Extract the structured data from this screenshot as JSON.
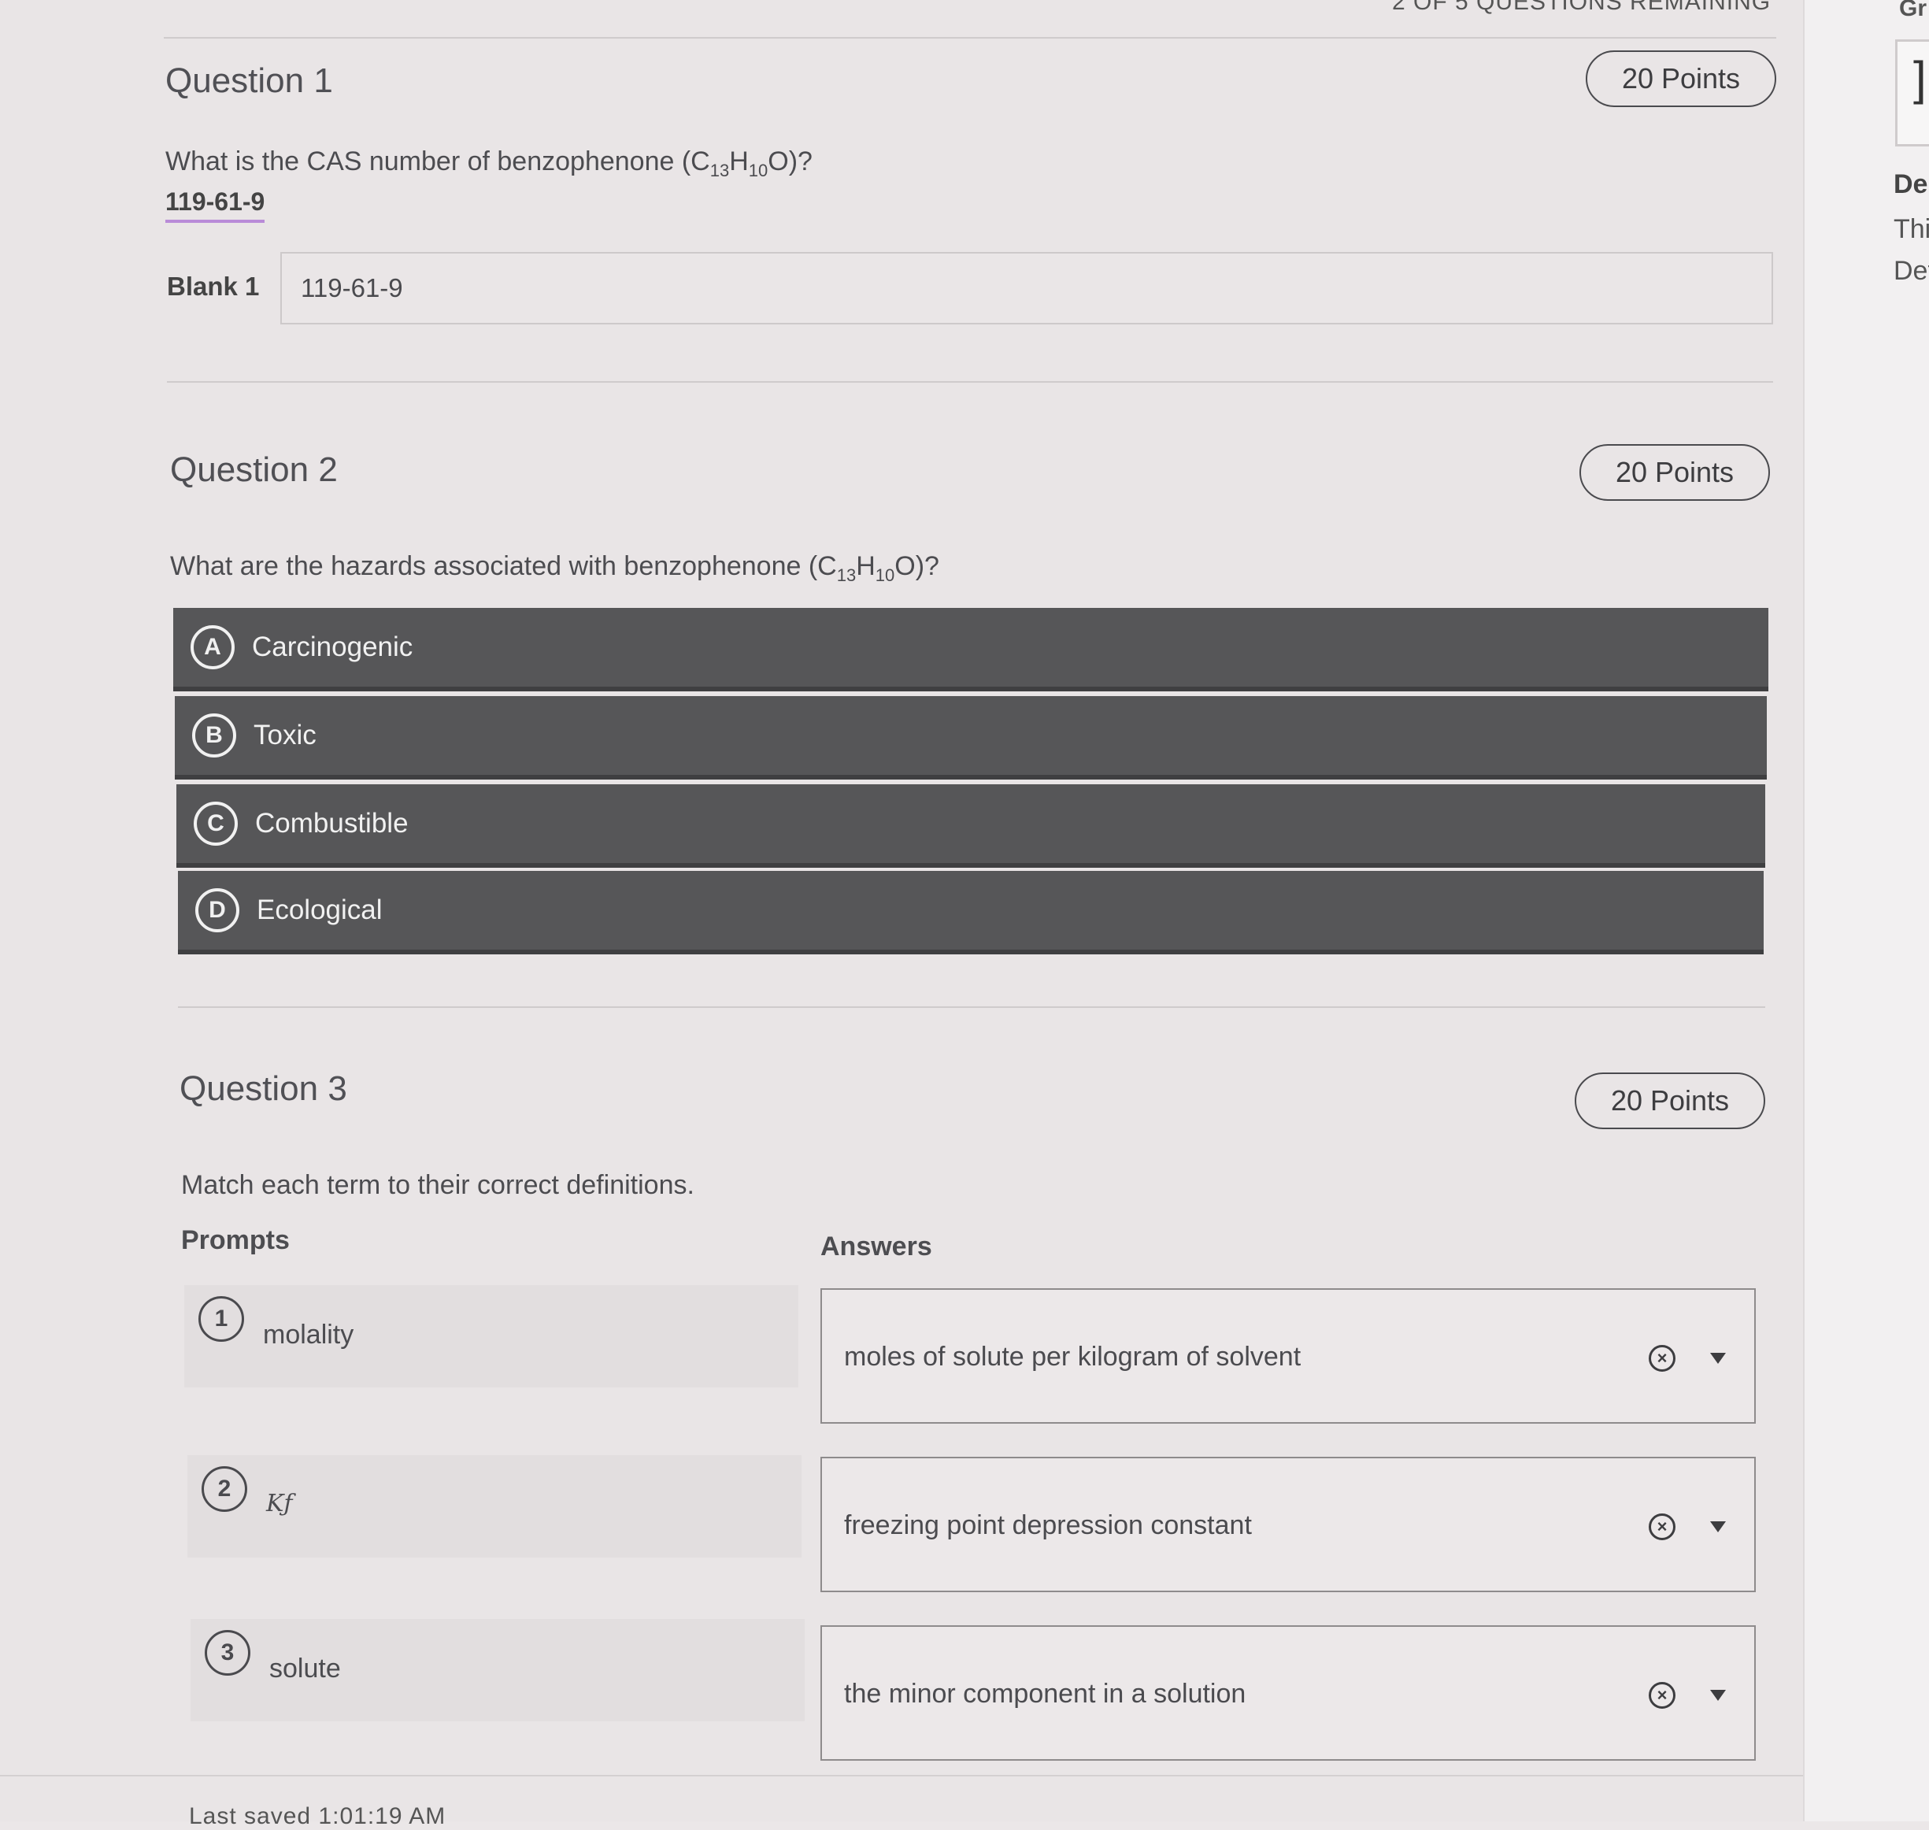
{
  "header": {
    "remaining": "2 OF 5 QUESTIONS REMAINING"
  },
  "side_panel": {
    "heading": "Gr",
    "detail_title": "De",
    "detail_line1": "Thi",
    "detail_line2": "Det",
    "box_glyph": "]"
  },
  "questions": [
    {
      "title": "Question 1",
      "points": "20 Points",
      "text_before": "What is the CAS number of benzophenone (C",
      "sub1": "13",
      "mid": "H",
      "sub2": "10",
      "text_after": "O)?",
      "answer_shown": "119-61-9",
      "blank_label": "Blank 1",
      "blank_value": "119-61-9"
    },
    {
      "title": "Question 2",
      "points": "20 Points",
      "text_before": "What are the hazards associated with benzophenone (C",
      "sub1": "13",
      "mid": "H",
      "sub2": "10",
      "text_after": "O)?",
      "options": [
        {
          "letter": "A",
          "label": "Carcinogenic"
        },
        {
          "letter": "B",
          "label": "Toxic"
        },
        {
          "letter": "C",
          "label": "Combustible"
        },
        {
          "letter": "D",
          "label": "Ecological"
        }
      ]
    },
    {
      "title": "Question 3",
      "points": "20 Points",
      "text": "Match each term to their correct definitions.",
      "prompts_header": "Prompts",
      "answers_header": "Answers",
      "pairs": [
        {
          "num": "1",
          "prompt": "molality",
          "answer": "moles of solute per kilogram of solvent"
        },
        {
          "num": "2",
          "prompt": "Kƒ",
          "answer": "freezing point depression constant"
        },
        {
          "num": "3",
          "prompt": "solute",
          "answer": "the minor component in a solution"
        }
      ]
    }
  ],
  "footer": {
    "saved": "Last saved 1:01:19 AM"
  },
  "icons": {
    "clear": "close-circle-icon",
    "dropdown": "chevron-down-icon"
  }
}
